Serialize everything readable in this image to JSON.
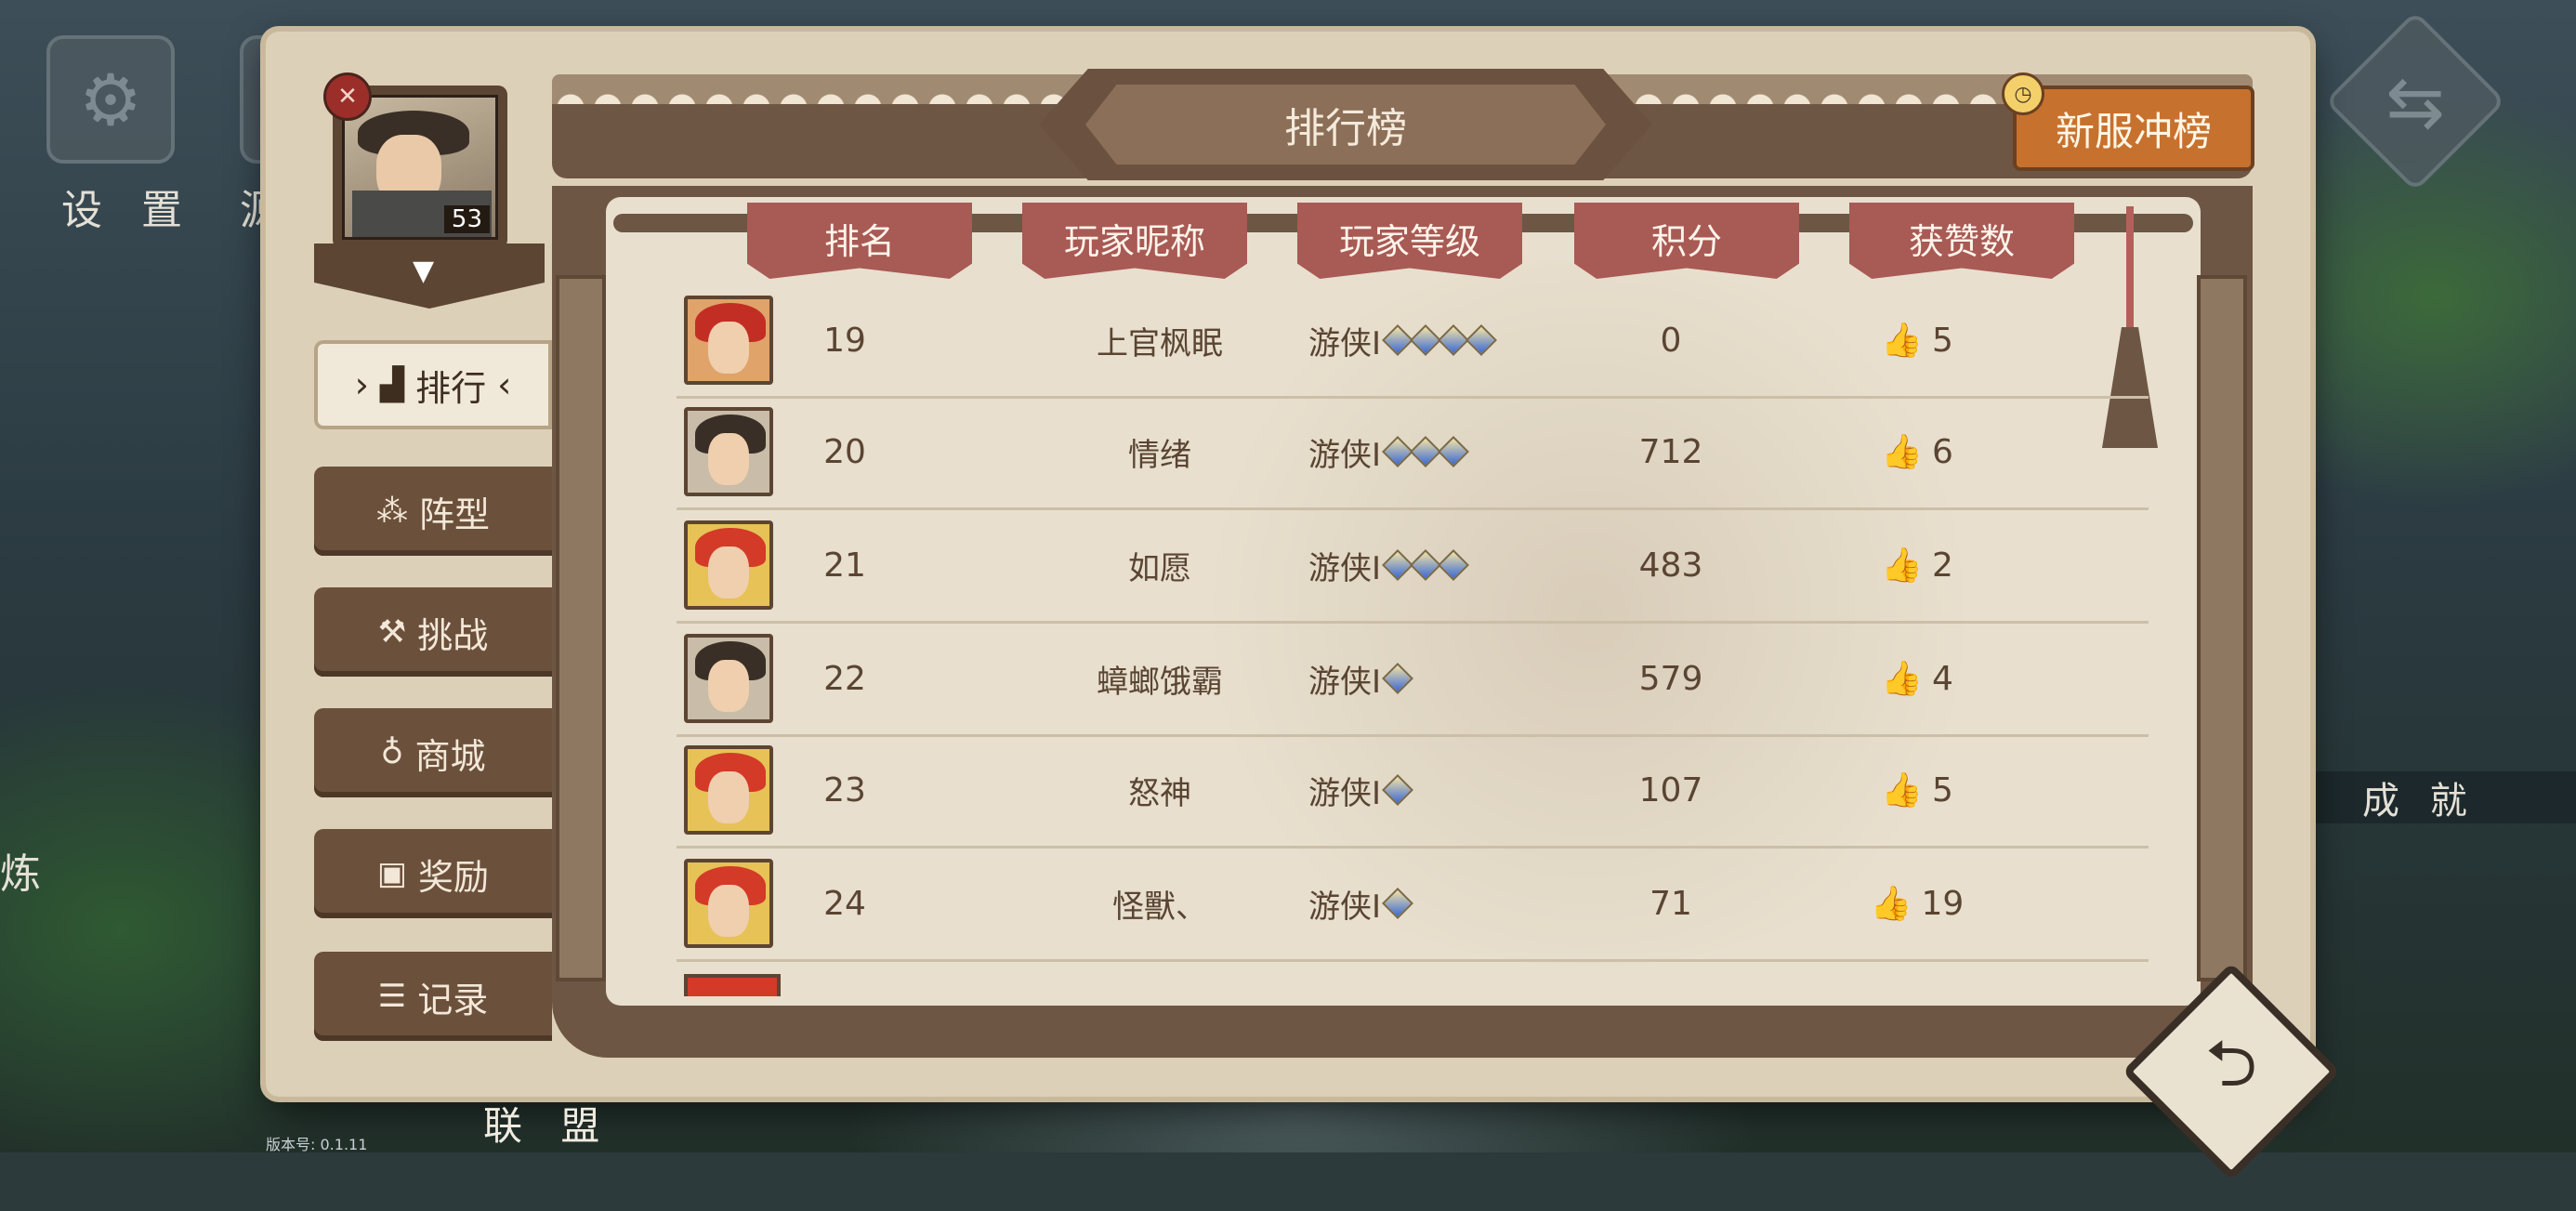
{
  "background": {
    "settings_label": "设 置",
    "partial_label": "源",
    "left_edge_label": "炼",
    "achievement_label": "成 就",
    "version_label": "版本号:",
    "version_value": "0.1.11",
    "alliance_label": "联 盟"
  },
  "player": {
    "level": "53",
    "badge_icon": "crossed-tools-icon"
  },
  "sidebar": {
    "items": [
      {
        "label": "排行",
        "icon": "ranking-podium-icon",
        "active": true
      },
      {
        "label": "阵型",
        "icon": "formation-icon",
        "active": false
      },
      {
        "label": "挑战",
        "icon": "crossed-hammers-icon",
        "active": false
      },
      {
        "label": "商城",
        "icon": "money-bag-icon",
        "active": false
      },
      {
        "label": "奖励",
        "icon": "treasure-chest-icon",
        "active": false
      },
      {
        "label": "记录",
        "icon": "scroll-icon",
        "active": false
      }
    ]
  },
  "header": {
    "title": "排行榜",
    "new_server_button": "新服冲榜"
  },
  "table": {
    "columns": [
      "排名",
      "玩家昵称",
      "玩家等级",
      "积分",
      "获赞数"
    ],
    "rows": [
      {
        "rank": "19",
        "name": "上官枫眠",
        "level": "游侠I",
        "diamonds": 4,
        "score": "0",
        "likes": "5",
        "liked": false,
        "avatar": "type-a"
      },
      {
        "rank": "20",
        "name": "情绪",
        "level": "游侠I",
        "diamonds": 3,
        "score": "712",
        "likes": "6",
        "liked": false,
        "avatar": "type-b"
      },
      {
        "rank": "21",
        "name": "如愿",
        "level": "游侠I",
        "diamonds": 3,
        "score": "483",
        "likes": "2",
        "liked": false,
        "avatar": "type-c"
      },
      {
        "rank": "22",
        "name": "蟑螂饿霸",
        "level": "游侠I",
        "diamonds": 1,
        "score": "579",
        "likes": "4",
        "liked": true,
        "avatar": "type-b"
      },
      {
        "rank": "23",
        "name": "怒神",
        "level": "游侠I",
        "diamonds": 1,
        "score": "107",
        "likes": "5",
        "liked": false,
        "avatar": "type-c"
      },
      {
        "rank": "24",
        "name": "怪獸、",
        "level": "游侠I",
        "diamonds": 1,
        "score": "71",
        "likes": "19",
        "liked": false,
        "avatar": "type-c"
      }
    ]
  },
  "colors": {
    "accent_orange": "#c7712e",
    "column_header_red": "#a85a55",
    "frame_brown": "#6e5644",
    "parchment": "#e8dfce",
    "liked_gold": "#e8b826"
  }
}
